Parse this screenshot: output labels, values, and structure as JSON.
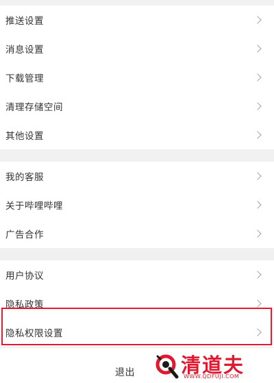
{
  "settings": {
    "group1": [
      {
        "label": "推送设置"
      },
      {
        "label": "消息设置"
      },
      {
        "label": "下载管理"
      },
      {
        "label": "清理存储空间"
      },
      {
        "label": "其他设置"
      }
    ],
    "group2": [
      {
        "label": "我的客服"
      },
      {
        "label": "关于哔哩哔哩"
      },
      {
        "label": "广告合作"
      }
    ],
    "group3": [
      {
        "label": "用户协议"
      },
      {
        "label": "隐私政策"
      },
      {
        "label": "隐私权限设置"
      }
    ]
  },
  "logout_label": "退出",
  "watermark": {
    "brand": "清道夫",
    "url": "WWW.QDFUJI.COM",
    "color": "#e11930"
  },
  "colors": {
    "highlight": "#e5162e",
    "chevron": "#a0a0a0"
  }
}
